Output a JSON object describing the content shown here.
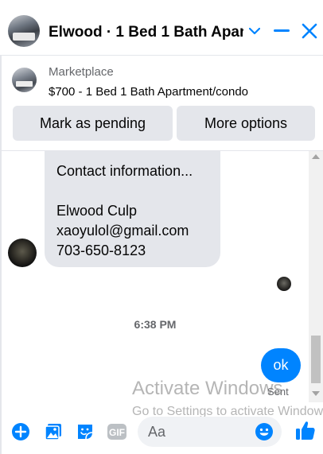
{
  "header": {
    "title": "Elwood · 1 Bed 1 Bath Apar...",
    "icons": [
      "chevron-down-icon",
      "minimize-icon",
      "close-icon"
    ]
  },
  "marketplace": {
    "label": "Marketplace",
    "listing": "$700 - 1 Bed 1 Bath Apartment/condo",
    "mark_pending_label": "Mark as pending",
    "more_options_label": "More options"
  },
  "messages": {
    "incoming": [
      "Contact information...",
      "",
      "Elwood Culp",
      "xaoyulol@gmail.com",
      "703-650-8123"
    ],
    "timestamp": "6:38 PM",
    "outgoing": "ok",
    "status": "Sent"
  },
  "watermark": {
    "title": "Activate Windows",
    "subtitle": "Go to Settings to activate Windows."
  },
  "composer": {
    "placeholder": "Aa",
    "icons": [
      "add-icon",
      "photo-icon",
      "sticker-icon",
      "gif-icon",
      "emoji-icon",
      "like-icon"
    ],
    "gif_label": "GIF"
  },
  "colors": {
    "accent": "#0084ff",
    "bubble_incoming": "#e4e6eb",
    "secondary_text": "#65676b"
  }
}
